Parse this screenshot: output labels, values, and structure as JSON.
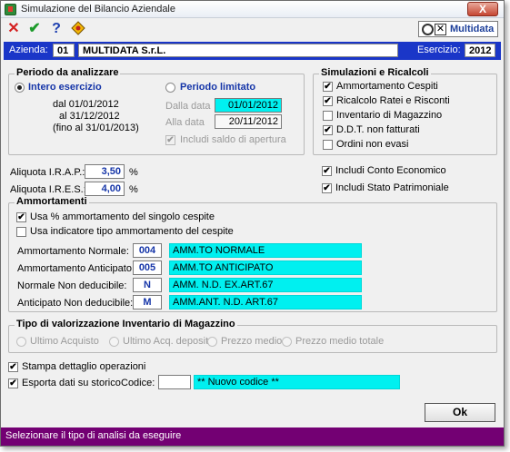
{
  "window": {
    "title": "Simulazione del Bilancio Aziendale",
    "close_label": "X"
  },
  "toolbar": {
    "cancel_icon": "✕",
    "confirm_icon": "✔",
    "help_icon": "?",
    "logo_x": "✕",
    "logo_text": "Multidata"
  },
  "header": {
    "azienda_label": "Azienda:",
    "azienda_code": "01",
    "azienda_name": "MULTIDATA S.r.L.",
    "esercizio_label": "Esercizio:",
    "esercizio_value": "2012"
  },
  "periodo": {
    "title": "Periodo da analizzare",
    "intero_label": "Intero esercizio",
    "intero_selected": true,
    "dal": "dal 01/01/2012",
    "al": "al 31/12/2012",
    "fino": "(fino al 31/01/2013)",
    "limitato_label": "Periodo limitato",
    "dalla_data_label": "Dalla data",
    "dalla_data_value": "01/01/2012",
    "alla_data_label": "Alla data",
    "alla_data_value": "20/11/2012",
    "saldo_label": "Includi saldo di apertura",
    "saldo_checked": true
  },
  "simulazioni": {
    "title": "Simulazioni e Ricalcoli",
    "items": [
      {
        "label": "Ammortamento Cespiti",
        "checked": true
      },
      {
        "label": "Ricalcolo Ratei e Risconti",
        "checked": true
      },
      {
        "label": "Inventario di Magazzino",
        "checked": false
      },
      {
        "label": "D.D.T. non fatturati",
        "checked": true
      },
      {
        "label": "Ordini non evasi",
        "checked": false
      }
    ]
  },
  "aliquote": {
    "irap_label": "Aliquota I.R.A.P.:",
    "irap_value": "3,50",
    "ires_label": "Aliquota I.R.E.S.:",
    "ires_value": "4,00",
    "percent": "%"
  },
  "includi": {
    "conto_economico_label": "Includi Conto Economico",
    "conto_economico_checked": true,
    "stato_patrimoniale_label": "Includi Stato Patrimoniale",
    "stato_patrimoniale_checked": true
  },
  "ammortamenti": {
    "title": "Ammortamenti",
    "usa_perc_label": "Usa % ammortamento del singolo cespite",
    "usa_perc_checked": true,
    "usa_indicatore_label": "Usa indicatore tipo ammortamento del cespite",
    "usa_indicatore_checked": false,
    "rows": [
      {
        "label": "Ammortamento Normale:",
        "code": "004",
        "desc": "AMM.TO NORMALE"
      },
      {
        "label": "Ammortamento Anticipato:",
        "code": "005",
        "desc": "AMM.TO ANTICIPATO"
      },
      {
        "label": "Normale Non deducibile:",
        "code": "N",
        "desc": "AMM. N.D. EX.ART.67"
      },
      {
        "label": "Anticipato Non deducibile:",
        "code": "M",
        "desc": "AMM.ANT. N.D. ART.67"
      }
    ]
  },
  "inventario": {
    "title": "Tipo di valorizzazione Inventario di Magazzino",
    "options": [
      "Ultimo Acquisto",
      "Ultimo Acq. deposito",
      "Prezzo medio",
      "Prezzo medio totale"
    ]
  },
  "opzioni": {
    "stampa_label": "Stampa dettaglio operazioni",
    "stampa_checked": true,
    "esporta_label": "Esporta dati su storico",
    "esporta_checked": true,
    "codice_label": "Codice:",
    "codice_value": "",
    "nuovo_codice": "** Nuovo codice **"
  },
  "ok_label": "Ok",
  "status": {
    "text": "Selezionare il tipo di analisi da eseguire"
  },
  "colors": {
    "header_blue": "#1a36c8",
    "status_purple": "#730073",
    "field_cyan": "#00f0f0"
  }
}
